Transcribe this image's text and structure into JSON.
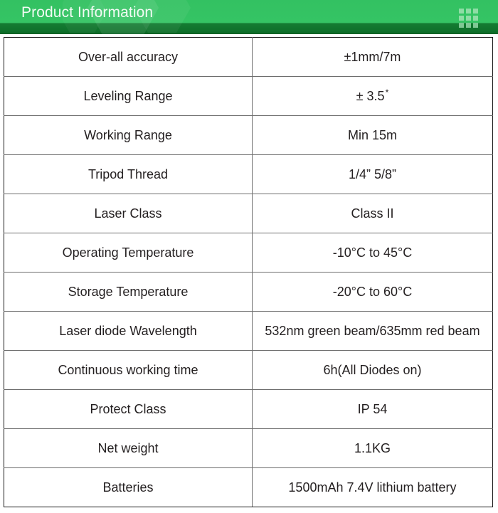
{
  "banner": {
    "title": "Product Information",
    "accent_color": "#33c162",
    "accent_dark_color": "#0e6f2a",
    "title_color": "#f2fbf4",
    "grid_icon": "grid-3x3-icon",
    "watermark_icon": "hexagon-watermark-icon"
  },
  "spec_table": {
    "rows": [
      {
        "label": "Over-all accuracy",
        "value": "±1mm/7m"
      },
      {
        "label": "Leveling Range",
        "value": "± 3.5",
        "superscript": "*"
      },
      {
        "label": "Working Range",
        "value": "Min 15m"
      },
      {
        "label": "Tripod Thread",
        "value": "1/4” 5/8”"
      },
      {
        "label": "Laser Class",
        "value": "Class II"
      },
      {
        "label": "Operating Temperature",
        "value": "-10°C to 45°C"
      },
      {
        "label": "Storage Temperature",
        "value": "-20°C to 60°C"
      },
      {
        "label": "Laser diode Wavelength",
        "value": "532nm green beam/635mm red beam"
      },
      {
        "label": "Continuous working time",
        "value": "6h(All Diodes on)"
      },
      {
        "label": "Protect Class",
        "value": "IP 54"
      },
      {
        "label": "Net weight",
        "value": "1.1KG"
      },
      {
        "label": "Batteries",
        "value": "1500mAh 7.4V lithium battery"
      }
    ]
  }
}
